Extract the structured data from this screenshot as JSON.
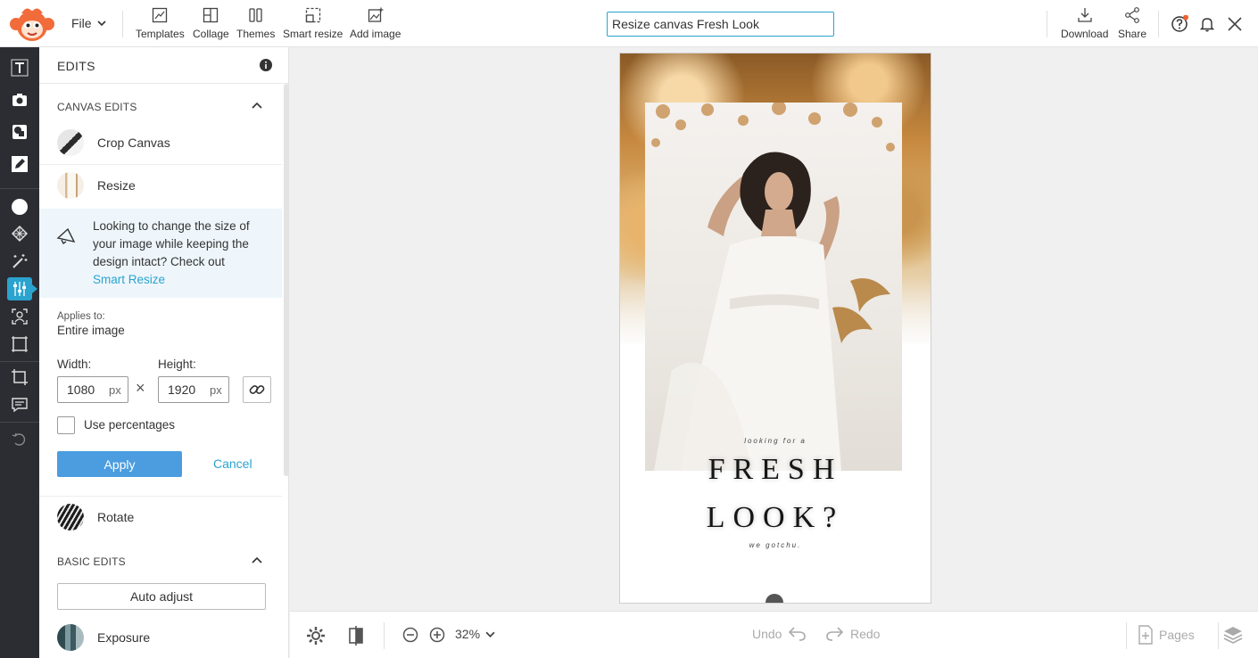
{
  "topbar": {
    "file_label": "File",
    "tools": [
      {
        "label": "Templates"
      },
      {
        "label": "Collage"
      },
      {
        "label": "Themes"
      },
      {
        "label": "Smart resize"
      },
      {
        "label": "Add image"
      }
    ],
    "title_value": "Resize canvas Fresh Look",
    "download_label": "Download",
    "share_label": "Share",
    "notification_dot_color": "#f06030"
  },
  "panel": {
    "title": "EDITS",
    "canvas_section": "CANVAS EDITS",
    "crop_label": "Crop Canvas",
    "resize_label": "Resize",
    "tip_text": "Looking to change the size of your image while keeping the design intact? Check out",
    "tip_link": "Smart Resize",
    "applies_label": "Applies to:",
    "applies_value": "Entire image",
    "width_label": "Width:",
    "height_label": "Height:",
    "width_value": "1080",
    "height_value": "1920",
    "unit": "px",
    "times": "×",
    "use_percentages_label": "Use percentages",
    "apply_label": "Apply",
    "cancel_label": "Cancel",
    "rotate_label": "Rotate",
    "basic_section": "BASIC EDITS",
    "auto_adjust_label": "Auto adjust",
    "exposure_label": "Exposure"
  },
  "poster": {
    "line1": "looking for a",
    "line2": "FRESH",
    "line3": "LOOK?",
    "line4": "we gotchu."
  },
  "bottombar": {
    "zoom": "32%",
    "undo": "Undo",
    "redo": "Redo",
    "pages": "Pages"
  },
  "colors": {
    "accent": "#2aa3cf",
    "apply_button": "#4b9de0",
    "rail_bg": "#2c2d33"
  }
}
